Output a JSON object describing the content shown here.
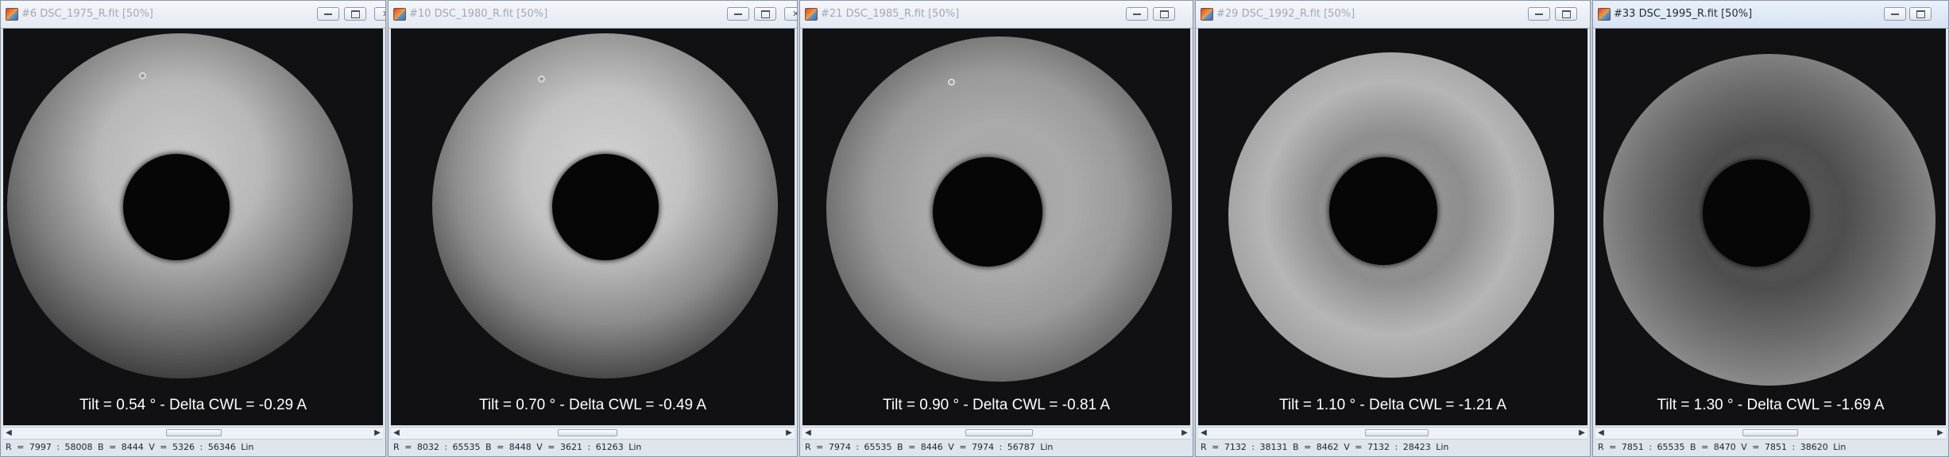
{
  "windows": [
    {
      "title": "#6 DSC_1975_R.fit  [50%]",
      "caption": "Tilt = 0.54 ° - Delta CWL = -0.29 A",
      "status": "R = 7997 : 58008    B = 8444    V = 5326 : 56346 Lin",
      "active": false
    },
    {
      "title": "#10 DSC_1980_R.fit  [50%]",
      "caption": "Tilt = 0.70 ° - Delta CWL = -0.49 A",
      "status": "R = 8032 : 65535    B = 8448    V = 3621 : 61263 Lin",
      "active": false
    },
    {
      "title": "#21 DSC_1985_R.fit  [50%]",
      "caption": "Tilt = 0.90 ° - Delta CWL = -0.81 A",
      "status": "R = 7974 : 65535    B = 8446    V = 7974 : 56787 Lin",
      "active": false
    },
    {
      "title": "#29 DSC_1992_R.fit  [50%]",
      "caption": "Tilt = 1.10 ° - Delta CWL = -1.21 A",
      "status": "R = 7132 : 38131    B = 8462    V = 7132 : 28423 Lin",
      "active": false
    },
    {
      "title": "#33 DSC_1995_R.fit  [50%]",
      "caption": "Tilt = 1.30 ° - Delta CWL = -1.69 A",
      "status": "R = 7851 : 65535    B = 8470    V = 7851 : 38620 Lin",
      "active": true
    }
  ],
  "icons": {
    "app": "fits-image-icon",
    "minimize": "minimize-icon",
    "maximize": "maximize-icon",
    "close": "close-icon",
    "scroll_left": "chevron-left-icon",
    "scroll_right": "chevron-right-icon"
  },
  "colors": {
    "image_background": "#111113",
    "caption_text": "#ffffff",
    "inactive_title_text": "#a1a8b3",
    "active_title_text": "#1e2a3a"
  }
}
